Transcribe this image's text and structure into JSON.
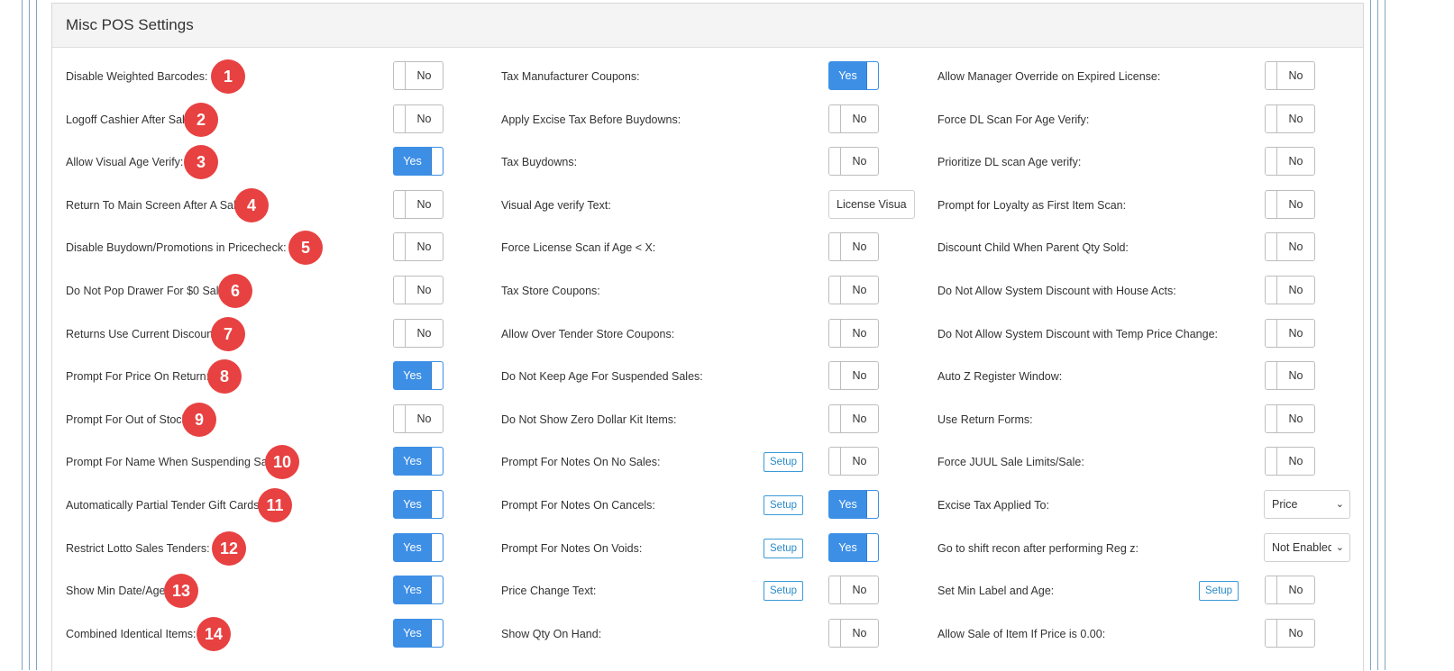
{
  "panel": {
    "title": "Misc POS Settings"
  },
  "rows": [
    {
      "col1": {
        "label": "Disable Weighted Barcodes:",
        "value": "No",
        "badge": "1"
      },
      "col2": {
        "label": "Tax Manufacturer Coupons:",
        "value": "Yes"
      },
      "col3": {
        "label": "Allow Manager Override on Expired License:",
        "value": "No"
      }
    },
    {
      "col1": {
        "label": "Logoff Cashier After Sale:",
        "value": "No",
        "badge": "2"
      },
      "col2": {
        "label": "Apply Excise Tax Before Buydowns:",
        "value": "No"
      },
      "col3": {
        "label": "Force DL Scan For Age Verify:",
        "value": "No"
      }
    },
    {
      "col1": {
        "label": "Allow Visual Age Verify:",
        "value": "Yes",
        "badge": "3"
      },
      "col2": {
        "label": "Tax Buydowns:",
        "value": "No"
      },
      "col3": {
        "label": "Prioritize DL scan Age verify:",
        "value": "No"
      }
    },
    {
      "col1": {
        "label": "Return To Main Screen After A Sale:",
        "value": "No",
        "badge": "4"
      },
      "col2": {
        "label": "Visual Age verify Text:",
        "value": "License Visual"
      },
      "col3": {
        "label": "Prompt for Loyalty as First Item Scan:",
        "value": "No"
      }
    },
    {
      "col1": {
        "label": "Disable Buydown/Promotions in Pricecheck:",
        "value": "No",
        "badge": "5"
      },
      "col2": {
        "label": "Force License Scan if Age < X:",
        "value": "No"
      },
      "col3": {
        "label": "Discount Child When Parent Qty Sold:",
        "value": "No"
      }
    },
    {
      "col1": {
        "label": "Do Not Pop Drawer For $0 Sales:",
        "value": "No",
        "badge": "6"
      },
      "col2": {
        "label": "Tax Store Coupons:",
        "value": "No"
      },
      "col3": {
        "label": "Do Not Allow System Discount with House Acts:",
        "value": "No"
      }
    },
    {
      "col1": {
        "label": "Returns Use Current Discount:",
        "value": "No",
        "badge": "7"
      },
      "col2": {
        "label": "Allow Over Tender Store Coupons:",
        "value": "No"
      },
      "col3": {
        "label": "Do Not Allow System Discount with Temp Price Change:",
        "value": "No"
      }
    },
    {
      "col1": {
        "label": "Prompt For Price On Return:",
        "value": "Yes",
        "badge": "8"
      },
      "col2": {
        "label": "Do Not Keep Age For Suspended Sales:",
        "value": "No"
      },
      "col3": {
        "label": "Auto Z Register Window:",
        "value": "No"
      }
    },
    {
      "col1": {
        "label": "Prompt For Out of Stock Item:",
        "value": "No",
        "badge": "9"
      },
      "col2": {
        "label": "Do Not Show Zero Dollar Kit Items:",
        "value": "No"
      },
      "col3": {
        "label": "Use Return Forms:",
        "value": "No"
      }
    },
    {
      "col1": {
        "label": "Prompt For Name When Suspending Sale:",
        "value": "Yes",
        "badge": "10"
      },
      "col2": {
        "label": "Prompt For Notes On No Sales:",
        "value": "No",
        "setup": "Setup"
      },
      "col3": {
        "label": "Force JUUL Sale Limits/Sale:",
        "value": "No"
      }
    },
    {
      "col1": {
        "label": "Automatically Partial Tender Gift Cards:",
        "value": "Yes",
        "badge": "11"
      },
      "col2": {
        "label": "Prompt For Notes On Cancels:",
        "value": "Yes",
        "setup": "Setup"
      },
      "col3": {
        "label": "Excise Tax Applied To:",
        "value": "Price"
      }
    },
    {
      "col1": {
        "label": "Restrict Lotto Sales Tenders:",
        "value": "Yes",
        "badge": "12"
      },
      "col2": {
        "label": "Prompt For Notes On Voids:",
        "value": "Yes",
        "setup": "Setup"
      },
      "col3": {
        "label": "Go to shift recon after performing Reg z:",
        "value": "Not Enabled"
      }
    },
    {
      "col1": {
        "label": "Show Min Date/Age:",
        "value": "Yes",
        "badge": "13"
      },
      "col2": {
        "label": "Price Change Text:",
        "value": "No",
        "setup": "Setup"
      },
      "col3": {
        "label": "Set Min Label and Age:",
        "value": "No",
        "setup": "Setup"
      }
    },
    {
      "col1": {
        "label": "Combined Identical Items:",
        "value": "Yes",
        "badge": "14"
      },
      "col2": {
        "label": "Show Qty On Hand:",
        "value": "No"
      },
      "col3": {
        "label": "Allow Sale of Item If Price is 0.00:",
        "value": "No"
      }
    }
  ],
  "colors": {
    "accent": "#3d8fe6",
    "badge": "#e84141",
    "setup": "#2a8bc9"
  }
}
